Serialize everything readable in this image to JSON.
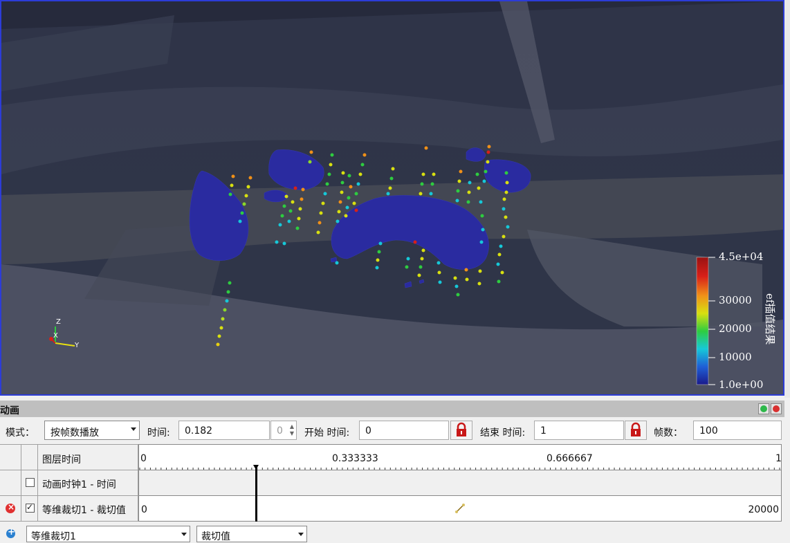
{
  "viewport": {
    "axes": {
      "z": "Z",
      "x": "X",
      "y": "Y"
    },
    "colorbar": {
      "max_label": "4.5e+04",
      "labels": [
        "30000",
        "20000",
        "10000"
      ],
      "min_label": "1.0e+00",
      "title": "ef插值结果",
      "colors": [
        "#1a1a8c",
        "#1f5fd6",
        "#16c8d8",
        "#2ecc40",
        "#d8e010",
        "#f09018",
        "#d82018",
        "#9a1212"
      ]
    }
  },
  "animation_panel": {
    "title": "动画",
    "mode_label": "模式：",
    "mode_value": "按帧数播放",
    "time_label": "时间:",
    "time_value": "0.182",
    "time_spin": "0",
    "start_time_label": "开始 时间:",
    "start_time_value": "0",
    "end_time_label": "结束 时间:",
    "end_time_value": "1",
    "frames_label": "帧数：",
    "frames_value": "100"
  },
  "tracks": {
    "header_label": "图层时间",
    "ticks": [
      "0",
      "0.333333",
      "0.666667",
      "1"
    ],
    "current_time_fraction": 0.182,
    "rows": [
      {
        "label": "动画时钟1 - 时间",
        "checked": false,
        "start_value": "",
        "end_value": ""
      },
      {
        "label": "等维裁切1 - 裁切值",
        "checked": true,
        "start_value": "0",
        "end_value": "20000"
      }
    ]
  },
  "add_track": {
    "source_value": "等维裁切1",
    "property_value": "裁切值"
  }
}
